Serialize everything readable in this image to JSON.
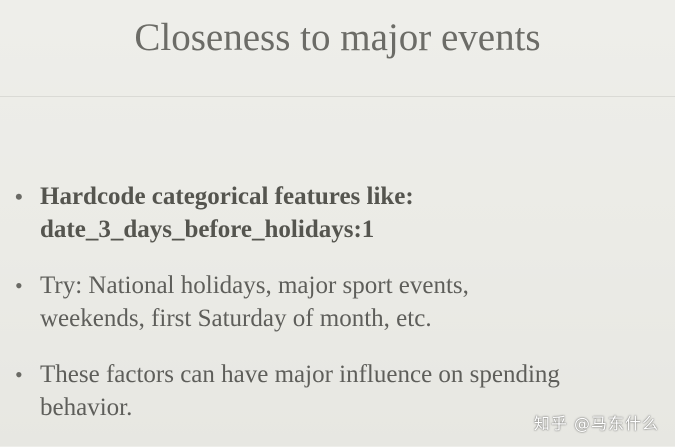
{
  "slide": {
    "title": "Closeness to major events",
    "bullets": [
      {
        "line1": "Hardcode categorical features like:",
        "line2": "date_3_days_before_holidays:1",
        "bold": true
      },
      {
        "line1": "Try: National holidays, major sport events,",
        "line2": "weekends, first Saturday of month, etc.",
        "bold": false
      },
      {
        "line1": "These factors can have major influence on spending",
        "line2": "behavior.",
        "bold": false
      }
    ],
    "bullet_glyph": "•"
  },
  "watermark": {
    "text": "知乎 @马东什么"
  },
  "colors": {
    "background": "#ebebe6",
    "title": "#6c6c67",
    "body_text": "#5e5e5a"
  }
}
